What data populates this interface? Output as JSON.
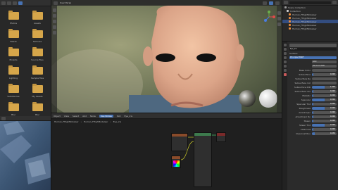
{
  "filebrowser": {
    "folders": [
      {
        "label": "Photos"
      },
      {
        "label": "Assets"
      },
      {
        "label": "Heads"
      },
      {
        "label": "Textures"
      },
      {
        "label": "Morphs"
      },
      {
        "label": "Source files"
      },
      {
        "label": "Lighting"
      },
      {
        "label": "Sample files"
      },
      {
        "label": "Substances"
      },
      {
        "label": "My Assets"
      },
      {
        "label": "Misc"
      },
      {
        "label": "Misc"
      }
    ]
  },
  "viewport": {
    "title": "User Persp"
  },
  "node_editor": {
    "menu": [
      "Object",
      "View",
      "Select",
      "Add",
      "Node",
      "Use Nodes",
      "Slot",
      "Eye_iris"
    ],
    "active_menu": "Use Nodes",
    "crumbs": [
      "Human_FHighModelser",
      "Human_FHighModelser",
      "Eye_iris"
    ]
  },
  "outliner": {
    "rows": [
      {
        "label": "Scene Collection",
        "color": "#9a9a9a",
        "selected": false
      },
      {
        "label": "Collection",
        "color": "#cfcfcf",
        "selected": false
      },
      {
        "label": "Human_FHighModelser",
        "color": "#e88a3c",
        "selected": false
      },
      {
        "label": "Human_FHighModelser",
        "color": "#e88a3c",
        "selected": false
      },
      {
        "label": "Human_FHighModelser",
        "color": "#e88a3c",
        "selected": true
      },
      {
        "label": "Human_FHighModelser",
        "color": "#e88a3c",
        "selected": false
      },
      {
        "label": "Human_FHighModelser",
        "color": "#e88a3c",
        "selected": false
      }
    ]
  },
  "properties": {
    "material_name": "Eye_iris",
    "surface_label": "Surface",
    "shader": "Principled BSDF",
    "distribution": "GGX",
    "subsurface_method": "Random Walk",
    "rows": [
      {
        "label": "Base Color",
        "value": "",
        "fill": 0
      },
      {
        "label": "Subsurface",
        "value": "0.000",
        "fill": 0.05
      },
      {
        "label": "Subsurface Ra",
        "value": "",
        "fill": 0
      },
      {
        "label": "Subsurface Col",
        "value": "",
        "fill": 0
      },
      {
        "label": "Subsurface IOR",
        "value": "1.400",
        "fill": 0.5
      },
      {
        "label": "Subsurface Ani",
        "value": "0.000",
        "fill": 0.05
      },
      {
        "label": "Metallic",
        "value": "0.000",
        "fill": 0.05
      },
      {
        "label": "Specular",
        "value": "0.500",
        "fill": 0.5
      },
      {
        "label": "Specular Tint",
        "value": "0.000",
        "fill": 0.05
      },
      {
        "label": "Roughness",
        "value": "0.500",
        "fill": 0.5
      },
      {
        "label": "Anisotropic",
        "value": "0.000",
        "fill": 0.05
      },
      {
        "label": "Anisotropic Ro",
        "value": "0.000",
        "fill": 0.05
      },
      {
        "label": "Sheen",
        "value": "0.000",
        "fill": 0.05
      },
      {
        "label": "Sheen Tint",
        "value": "0.500",
        "fill": 0.5
      },
      {
        "label": "Clearcoat",
        "value": "0.000",
        "fill": 0.05
      },
      {
        "label": "Clearcoat Rou",
        "value": "0.030",
        "fill": 0.1
      }
    ]
  },
  "colors": {
    "accent": "#4772b3",
    "folder": "#d6a64a",
    "object": "#e88a3c"
  }
}
